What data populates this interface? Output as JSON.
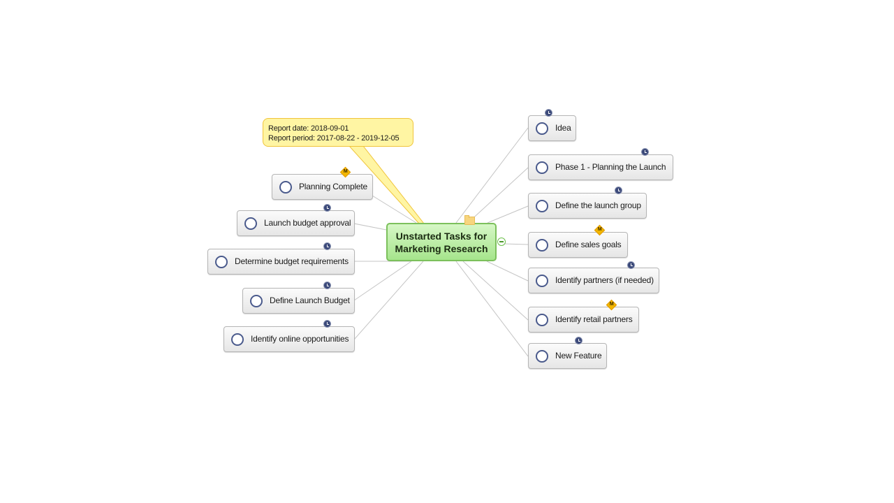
{
  "central_topic": {
    "title_line1": "Unstarted Tasks for",
    "title_line2": "Marketing Research",
    "icon": "folder-icon",
    "toggle": "collapse-icon"
  },
  "callout": {
    "report_date_label": "Report date:",
    "report_date": "2018-09-01",
    "report_period_label": "Report period:",
    "report_period": "2017-08-22 - 2019-12-05",
    "line1": "Report date: 2018-09-01",
    "line2": "Report period: 2017-08-22 - 2019-12-05"
  },
  "left_topics": [
    {
      "label": "Planning Complete",
      "status": "not-started",
      "badge": "milestone"
    },
    {
      "label": "Launch budget approval",
      "status": "not-started",
      "badge": "clock"
    },
    {
      "label": "Determine budget requirements",
      "status": "not-started",
      "badge": "clock"
    },
    {
      "label": "Define Launch Budget",
      "status": "not-started",
      "badge": "clock"
    },
    {
      "label": "Identify online opportunities",
      "status": "not-started",
      "badge": "clock"
    }
  ],
  "right_topics": [
    {
      "label": "Idea",
      "status": "not-started",
      "badge": "clock"
    },
    {
      "label": "Phase 1 - Planning the Launch",
      "status": "not-started",
      "badge": "clock"
    },
    {
      "label": "Define the launch group",
      "status": "not-started",
      "badge": "clock"
    },
    {
      "label": "Define sales goals",
      "status": "not-started",
      "badge": "milestone"
    },
    {
      "label": "Identify partners (if needed)",
      "status": "not-started",
      "badge": "clock"
    },
    {
      "label": "Identify retail partners",
      "status": "not-started",
      "badge": "milestone"
    },
    {
      "label": "New Feature",
      "status": "not-started",
      "badge": "clock"
    }
  ],
  "milestone_badge_letter": "M",
  "colors": {
    "central_fill": "#a6e58c",
    "central_border": "#7cc05c",
    "callout_fill": "#fff5a3",
    "callout_border": "#f0c43a",
    "clock_badge": "#3c4a7a",
    "milestone_badge": "#f2b600",
    "link_line": "#c4c4c4"
  }
}
